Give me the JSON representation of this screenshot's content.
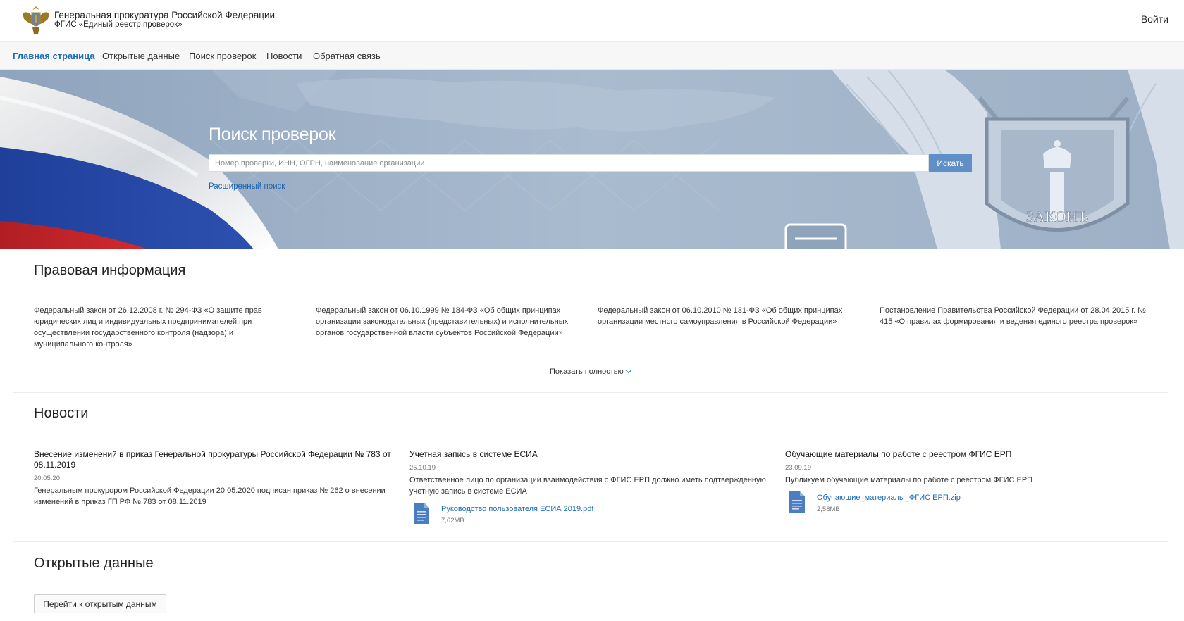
{
  "header": {
    "org_name": "Генеральная прокуратура Российской Федерации",
    "org_sub": "ФГИС «Единый реестр проверок»",
    "login": "Войти"
  },
  "nav": {
    "items": [
      {
        "label": "Главная страница",
        "active": true
      },
      {
        "label": "Открытые данные"
      },
      {
        "label": "Поиск проверок"
      },
      {
        "label": "Новости"
      },
      {
        "label": "Обратная связь"
      }
    ]
  },
  "hero": {
    "title": "Поиск проверок",
    "search_placeholder": "Номер проверки, ИНН, ОГРН, наименование организации",
    "search_button": "Искать",
    "advanced_link": "Расширенный поиск",
    "shield_text": "ЗАКОНЪ"
  },
  "legal": {
    "title": "Правовая информация",
    "items": [
      "Федеральный закон от 26.12.2008 г. № 294-ФЗ «О защите прав юридических лиц и индивидуальных предпринимателей при осуществлении государственного контроля (надзора) и муниципального контроля»",
      "Федеральный закон от 06.10.1999 № 184-ФЗ «Об общих принципах организации законодательных (представительных) и исполнительных органов государственной власти субъектов Российской Федерации»",
      "Федеральный закон от 06.10.2010 № 131-ФЗ «Об общих принципах организации местного самоуправления в Российской Федерации»",
      "Постановление Правительства Российской Федерации от 28.04.2015 г. № 415 «О правилах формирования и ведения единого реестра проверок»"
    ],
    "show_more": "Показать полностью"
  },
  "news": {
    "title": "Новости",
    "items": [
      {
        "title": "Внесение изменений в приказ Генеральной прокуратуры Российской Федерации № 783 от 08.11.2019",
        "date": "20.05.20",
        "text": "Генеральным прокурором Российской Федерации 20.05.2020 подписан приказ № 262 о внесении изменений в приказ ГП РФ № 783 от 08.11.2019"
      },
      {
        "title": "Учетная запись в системе ЕСИА",
        "date": "25.10.19",
        "text": "Ответственное лицо по организации взаимодействия с ФГИС ЕРП должно иметь подтвержденную учетную запись в системе ЕСИА",
        "file": {
          "name": "Руководство пользователя ЕСИА 2019.pdf",
          "size": "7,62MB",
          "icon": "document-icon"
        }
      },
      {
        "title": "Обучающие материалы по работе с реестром ФГИС ЕРП",
        "date": "23.09.19",
        "text": "Публикуем обучающие материалы по работе с реестром ФГИС ЕРП",
        "file": {
          "name": "Обучающие_материалы_ФГИС ЕРП.zip",
          "size": "2,58MB",
          "icon": "document-icon"
        }
      }
    ]
  },
  "open_data": {
    "title": "Открытые данные",
    "button": "Перейти к открытым данным"
  },
  "colors": {
    "accent": "#1e6cb5",
    "button": "#5f8fc6",
    "hero_bg": "#9fb2c8"
  }
}
